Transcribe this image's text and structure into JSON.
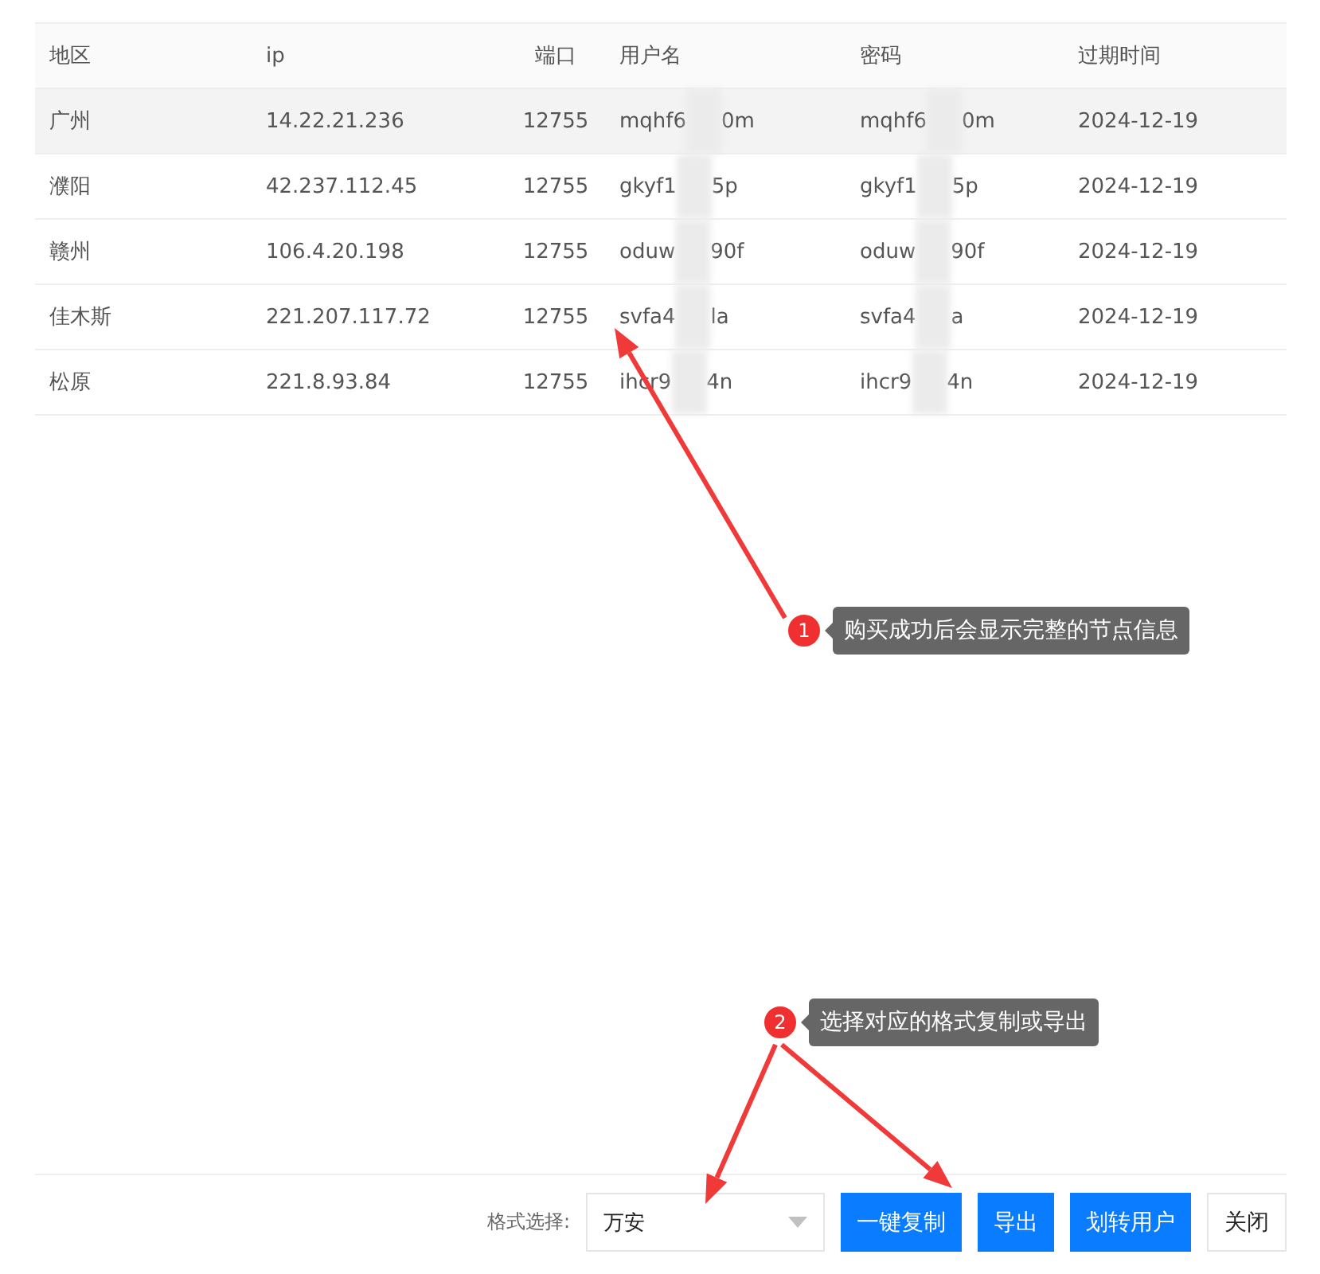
{
  "table": {
    "columns": [
      "地区",
      "ip",
      "端口",
      "用户名",
      "密码",
      "过期时间"
    ],
    "rows": [
      {
        "hovered": true,
        "region": "广州",
        "ip": "14.22.21.236",
        "port": "12755",
        "username": [
          "mqhf6",
          "0m"
        ],
        "password": [
          "mqhf6",
          "0m"
        ],
        "expires": "2024-12-19"
      },
      {
        "hovered": false,
        "region": "濮阳",
        "ip": "42.237.112.45",
        "port": "12755",
        "username": [
          "gkyf1",
          "5p"
        ],
        "password": [
          "gkyf1",
          "5p"
        ],
        "expires": "2024-12-19"
      },
      {
        "hovered": false,
        "region": "赣州",
        "ip": "106.4.20.198",
        "port": "12755",
        "username": [
          "oduw",
          "90f"
        ],
        "password": [
          "oduw",
          "90f"
        ],
        "expires": "2024-12-19"
      },
      {
        "hovered": false,
        "region": "佳木斯",
        "ip": "221.207.117.72",
        "port": "12755",
        "username": [
          "svfa4",
          "la"
        ],
        "password": [
          "svfa4",
          "a"
        ],
        "expires": "2024-12-19"
      },
      {
        "hovered": false,
        "region": "松原",
        "ip": "221.8.93.84",
        "port": "12755",
        "username": [
          "ihcr9",
          "4n"
        ],
        "password": [
          "ihcr9",
          "4n"
        ],
        "expires": "2024-12-19"
      }
    ]
  },
  "annotations": [
    {
      "number": "1",
      "text": "购买成功后会显示完整的节点信息"
    },
    {
      "number": "2",
      "text": "选择对应的格式复制或导出"
    }
  ],
  "footer": {
    "format_label": "格式选择:",
    "format_select": {
      "value": "万安"
    },
    "buttons": [
      {
        "label": "一键复制",
        "kind": "primary"
      },
      {
        "label": "导出",
        "kind": "primary"
      },
      {
        "label": "划转用户",
        "kind": "primary"
      },
      {
        "label": "关闭",
        "kind": "default"
      }
    ]
  }
}
